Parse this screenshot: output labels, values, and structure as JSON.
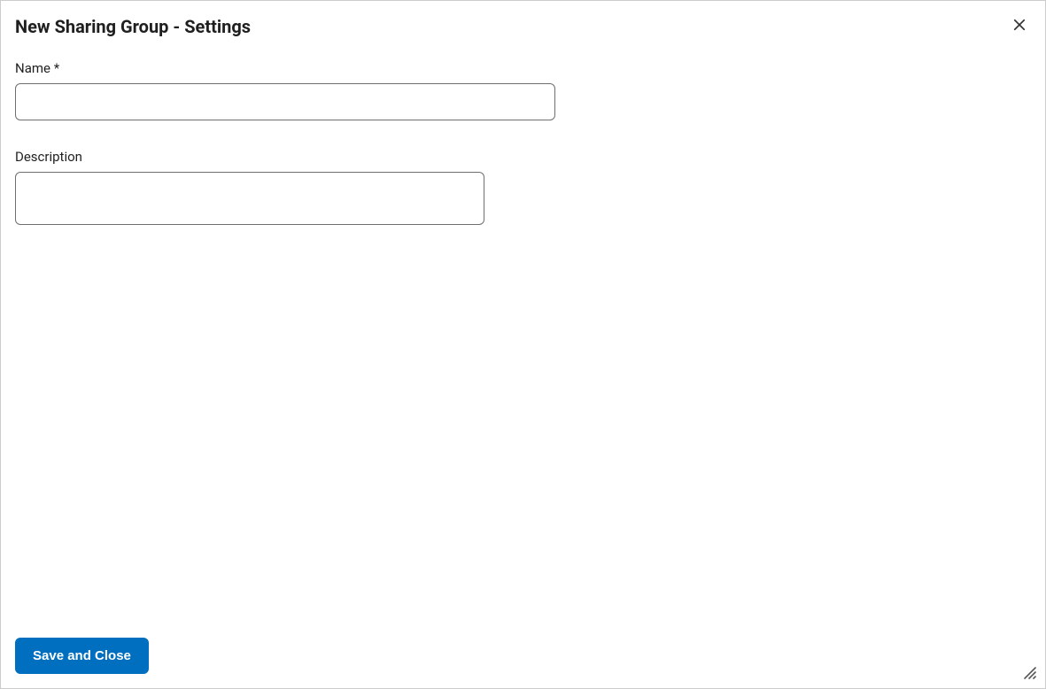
{
  "dialog": {
    "title": "New Sharing Group - Settings"
  },
  "form": {
    "name": {
      "label": "Name *",
      "value": ""
    },
    "description": {
      "label": "Description",
      "value": ""
    }
  },
  "footer": {
    "save_label": "Save and Close"
  }
}
